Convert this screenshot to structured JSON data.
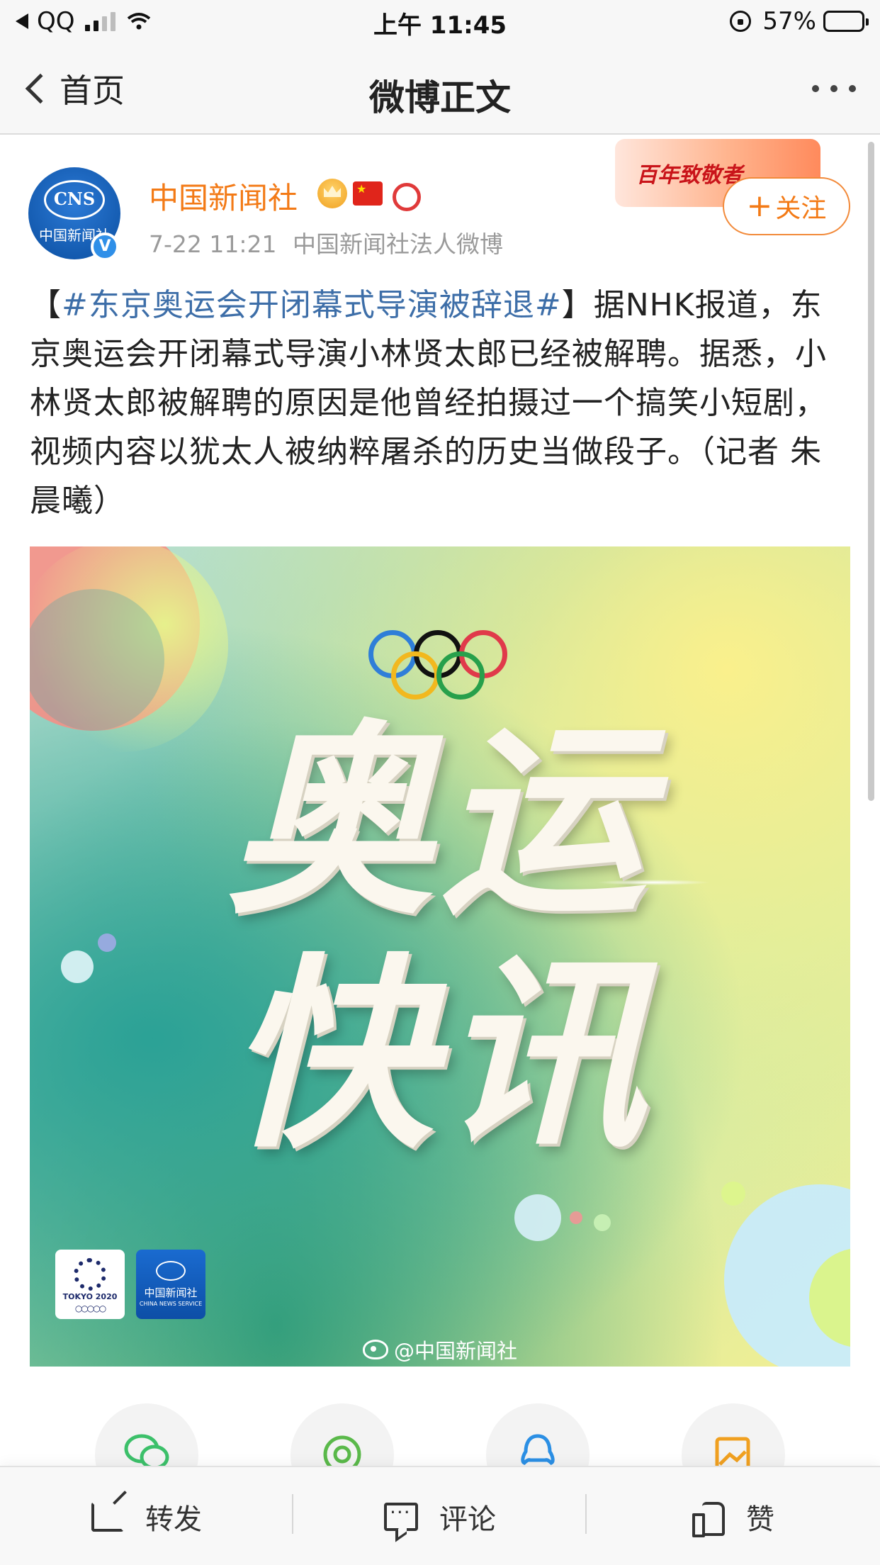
{
  "status_bar": {
    "back_app": "QQ",
    "time": "上午 11:45",
    "battery_percent": "57%",
    "battery_level": 0.57
  },
  "nav": {
    "back_label": "首页",
    "title": "微博正文"
  },
  "post": {
    "user_name": "中国新闻社",
    "timestamp": "7-22 11:21",
    "source": "中国新闻社法人微博",
    "follow_label": "关注",
    "anniversary_banner": "百年致敬者",
    "avatar_text": "CNS",
    "avatar_cn": "中国新闻社",
    "bracket_open": "【",
    "topic": "#东京奥运会开闭幕式导演被辞退#",
    "body_text": "】据NHK报道，东京奥运会开闭幕式导演小林贤太郎已经被解聘。据悉，小林贤太郎被解聘的原因是他曾经拍摄过一个搞笑小短剧，视频内容以犹太人被纳粹屠杀的历史当做段子。（记者 朱晨曦）"
  },
  "image": {
    "headline_line1": "奥运",
    "headline_line2": "快讯",
    "tokyo_logo_text": "TOKYO 2020",
    "cns_logo_cn": "中国新闻社",
    "cns_logo_en": "CHINA NEWS SERVICE",
    "watermark": "@中国新闻社"
  },
  "actions": {
    "repost": "转发",
    "comment": "评论",
    "like": "赞"
  },
  "colors": {
    "accent_orange": "#f37a16",
    "topic_blue": "#3d6ea8",
    "verified_blue": "#2f8fe8"
  }
}
